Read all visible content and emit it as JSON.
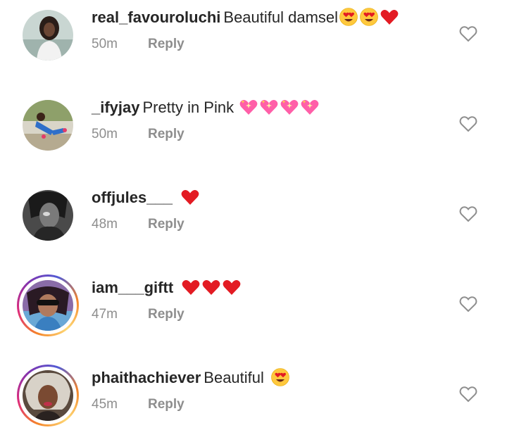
{
  "colors": {
    "text": "#262626",
    "muted": "#8e8e8e",
    "heart_red": "#e31b23",
    "sparkle_heart": "#ff5fa8"
  },
  "comments": [
    {
      "username": "real_favouroluchi",
      "text": "Beautiful damsel",
      "emojis": [
        "heart-eyes-emoji",
        "heart-eyes-emoji",
        "red-heart-emoji"
      ],
      "time": "50m",
      "reply_label": "Reply",
      "story_ring": false
    },
    {
      "username": "_ifyjay",
      "text": "Pretty in Pink",
      "emojis": [
        "sparkling-heart-emoji",
        "sparkling-heart-emoji",
        "sparkling-heart-emoji",
        "sparkling-heart-emoji"
      ],
      "time": "50m",
      "reply_label": "Reply",
      "story_ring": false
    },
    {
      "username": "offjules___",
      "text": "",
      "emojis": [
        "red-heart-emoji"
      ],
      "time": "48m",
      "reply_label": "Reply",
      "story_ring": false
    },
    {
      "username": "iam___giftt",
      "text": "",
      "emojis": [
        "red-heart-emoji",
        "red-heart-emoji",
        "red-heart-emoji"
      ],
      "time": "47m",
      "reply_label": "Reply",
      "story_ring": true
    },
    {
      "username": "phaithachiever",
      "text": "Beautiful",
      "emojis": [
        "heart-eyes-emoji"
      ],
      "time": "45m",
      "reply_label": "Reply",
      "story_ring": true
    }
  ]
}
